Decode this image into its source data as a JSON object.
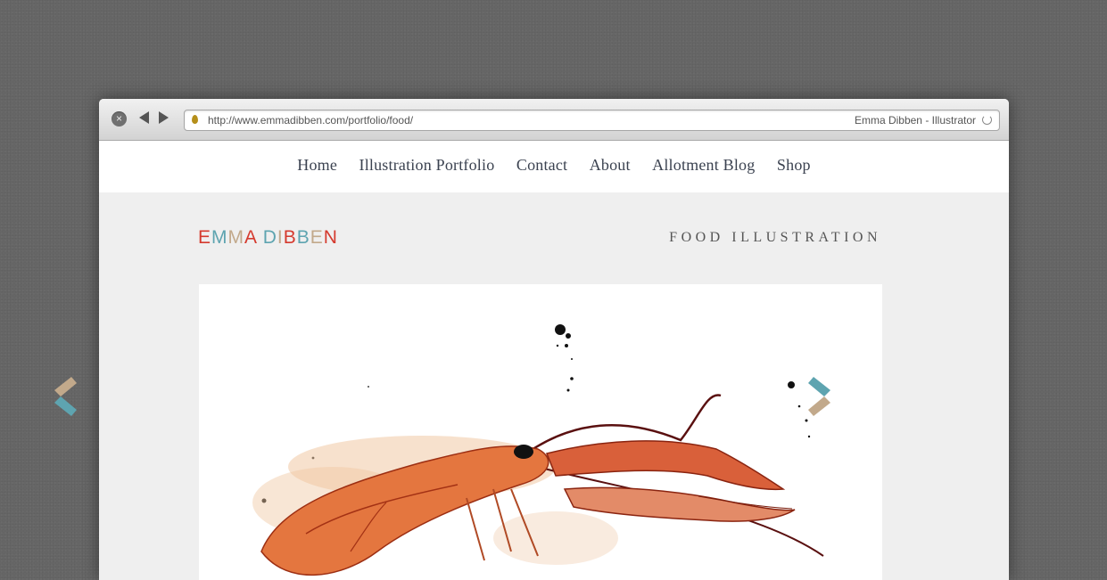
{
  "browser": {
    "url": "http://www.emmadibben.com/portfolio/food/",
    "page_title": "Emma Dibben - Illustrator"
  },
  "nav": {
    "items": [
      "Home",
      "Illustration Portfolio",
      "Contact",
      "About",
      "Allotment Blog",
      "Shop"
    ]
  },
  "header": {
    "logo": "EMMA DIBBEN",
    "section_title": "FOOD ILLUSTRATION"
  },
  "colors": {
    "logo_red": "#d53a2e",
    "logo_teal": "#5ea4b0",
    "logo_tan": "#c2a98b",
    "nav_text": "#3b4250"
  },
  "gallery": {
    "image_subject": "crayfish-illustration",
    "prev_icon": "chevron-left-icon",
    "next_icon": "chevron-right-icon"
  }
}
